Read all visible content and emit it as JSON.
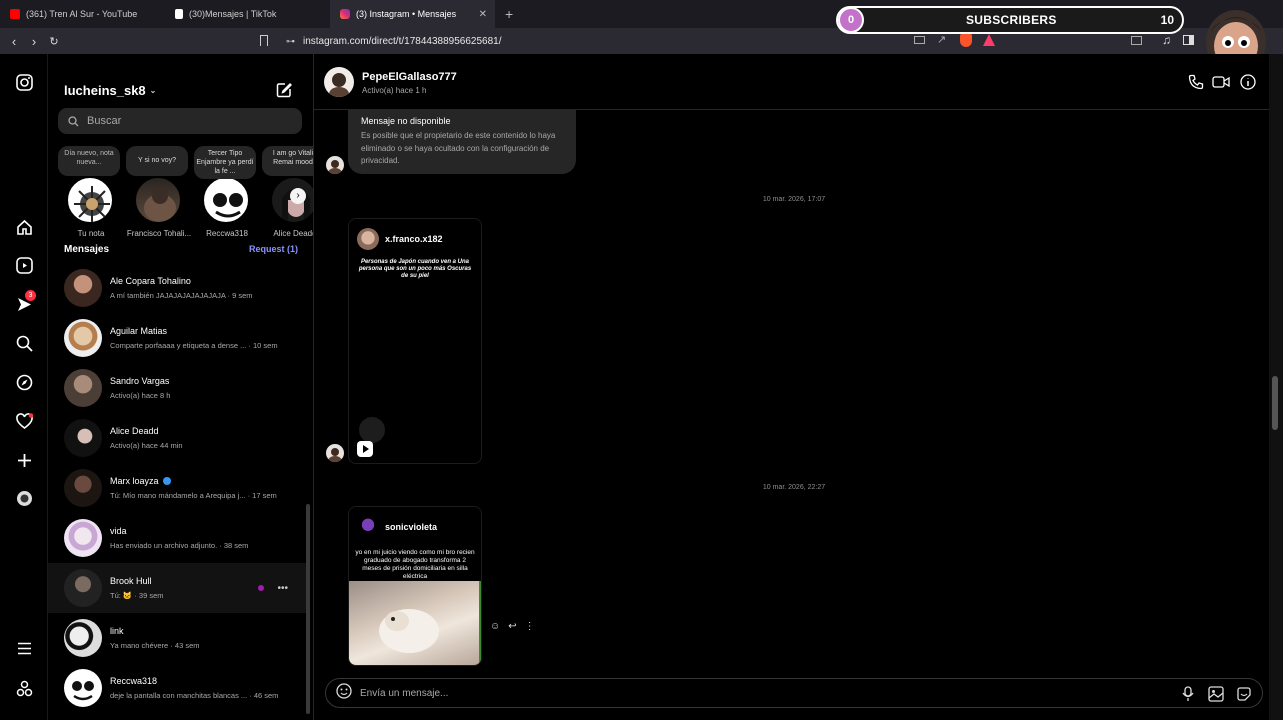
{
  "browser": {
    "tabs": [
      {
        "label": "(361) Tren Al Sur - YouTube",
        "color": "#ff0000"
      },
      {
        "label": "(30)Mensajes | TikTok",
        "color": "#ffffff"
      },
      {
        "label": "(3) Instagram • Mensajes",
        "color": "#e1306c",
        "active": true
      }
    ],
    "new_tab": "+",
    "url": "instagram.com/direct/t/17844388956625681/"
  },
  "overlay": {
    "subscribers_count": "0",
    "subscribers_label": "SUBSCRIBERS",
    "subscribers_goal": "10"
  },
  "rail": {
    "notification_count": "3"
  },
  "sidebar": {
    "username": "lucheins_sk8",
    "search_placeholder": "Buscar",
    "notes": [
      {
        "bubble": "Día nuevo, nota nueva...",
        "name": "Tu nota"
      },
      {
        "bubble": "Y si no voy?",
        "name": "Francisco Tohali..."
      },
      {
        "bubble": "Tercer Tipo Enjambre ya perdí la fe ...",
        "name": "Reccwa318"
      },
      {
        "bubble": "I am go Vitali Remai mood",
        "name": "Alice Deadd"
      }
    ],
    "section_title": "Mensajes",
    "requests": "Request (1)",
    "conversations": [
      {
        "name": "Ale Copara Tohalino",
        "sub": "A mí también JAJAJAJAJAJAJAJA · 9 sem"
      },
      {
        "name": "Aguilar Matias",
        "sub": "Comparte porfaaaa y etiqueta a dense ... · 10 sem"
      },
      {
        "name": "Sandro Vargas",
        "sub": "Activo(a) hace 8 h"
      },
      {
        "name": "Alice Deadd",
        "sub": "Activo(a) hace 44 min"
      },
      {
        "name": "Marx loayza",
        "sub": "Tú: Mío mano mándamelo a Arequipa j... · 17 sem",
        "verified": true
      },
      {
        "name": "vida",
        "sub": "Has enviado un archivo adjunto. · 38 sem"
      },
      {
        "name": "Brook Hull",
        "sub": "Tú: 🐱 · 39 sem"
      },
      {
        "name": "link",
        "sub": "Ya mano chévere · 43 sem"
      },
      {
        "name": "Reccwa318",
        "sub": "deje la pantalla con manchitas blancas ... · 46 sem"
      }
    ]
  },
  "chat": {
    "contact_name": "PepeElGallaso777",
    "contact_status": "Activo(a) hace 1 h",
    "unavailable_title": "Mensaje no disponible",
    "unavailable_text": "Es posible que el propietario de este contenido lo haya eliminado o se haya ocultado con la configuración de privacidad.",
    "timestamp_1": "10 mar. 2026, 17:07",
    "reel_1_author": "x.franco.x182",
    "reel_1_caption": "Personas de Japón cuando ven a Una persona que son un poco más Oscuras de su piel",
    "timestamp_2": "10 mar. 2026, 22:27",
    "reel_2_author": "sonicvioleta",
    "reel_2_caption": "yo en mi juicio viendo como mi bro recien graduado de abogado transforma 2 meses de prisión domiciliaria en silla eléctrica",
    "composer_placeholder": "Envía un mensaje..."
  }
}
